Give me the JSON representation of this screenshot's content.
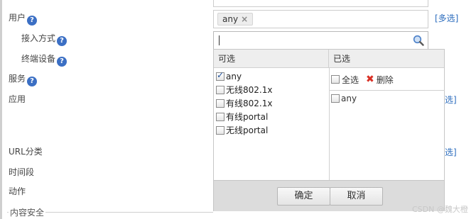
{
  "form": {
    "user_label": "用户",
    "access_label": "接入方式",
    "terminal_label": "终端设备",
    "service_label": "服务",
    "app_label": "应用",
    "url_label": "URL分类",
    "time_label": "时间段",
    "action_label": "动作",
    "content_security_label": "内容安全",
    "help_glyph": "?",
    "multi_select_link": "[多选]",
    "multi_select_partial": "选]"
  },
  "user_field": {
    "tags": [
      "any"
    ],
    "tag_remove_glyph": "×",
    "search_value": ""
  },
  "picker": {
    "available_header": "可选",
    "selected_header": "已选",
    "options": [
      {
        "label": "any",
        "checked": true
      },
      {
        "label": "无线802.1x",
        "checked": false
      },
      {
        "label": "有线802.1x",
        "checked": false
      },
      {
        "label": "有线portal",
        "checked": false
      },
      {
        "label": "无线portal",
        "checked": false
      }
    ],
    "select_all_label": "全选",
    "delete_label": "删除",
    "selected_items": [
      "any"
    ],
    "ok_label": "确定",
    "cancel_label": "取消"
  },
  "watermark": "CSDN @魏大橙",
  "icons": {
    "help": "question-circle-icon",
    "search": "magnifier-icon",
    "delete": "red-x-icon",
    "tag_remove": "close-icon"
  },
  "colors": {
    "link": "#2a6bbd",
    "help_icon": "#3b6fc4",
    "delete_icon": "#d93025",
    "panel_footer": "#dcdcdc",
    "column_header": "#eeeeee"
  }
}
